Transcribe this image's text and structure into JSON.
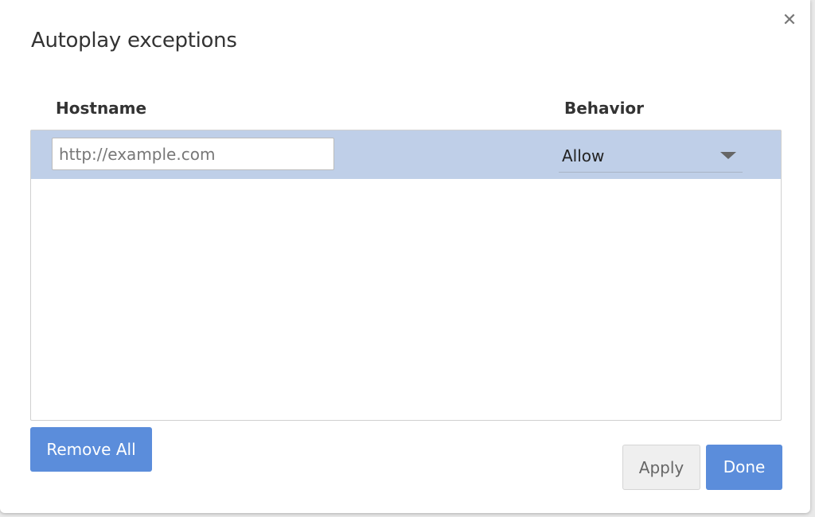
{
  "dialog": {
    "title": "Autoplay exceptions",
    "close_icon": "close-icon"
  },
  "table": {
    "columns": [
      "Hostname",
      "Behavior"
    ],
    "new_row": {
      "hostname_placeholder": "http://example.com",
      "hostname_value": "",
      "behavior": "Allow"
    }
  },
  "buttons": {
    "remove_all": "Remove All",
    "apply": "Apply",
    "done": "Done"
  },
  "colors": {
    "accent": "#5b8ddb",
    "selected_row": "#bfcfe8"
  }
}
